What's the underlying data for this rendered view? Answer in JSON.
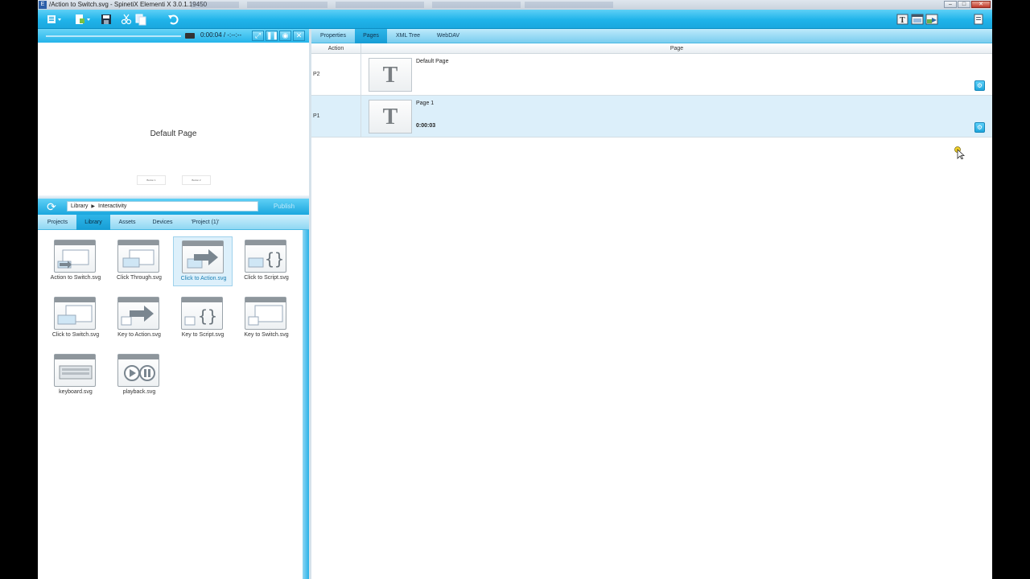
{
  "window": {
    "title": "/Action to Switch.svg - SpinetiX Elementi X 3.0.1.19450",
    "app_icon": "E",
    "controls": {
      "minimize": "–",
      "maximize": "□",
      "close": "✕"
    }
  },
  "toolbar": {
    "icons": [
      "menu-icon",
      "new-document-icon",
      "save-icon",
      "cut-icon",
      "copy-icon",
      "undo-icon",
      "text-layer-icon",
      "layout-icon",
      "media-icon",
      "page-icon"
    ]
  },
  "preview": {
    "timecode": "0:00:04 / -:--:--",
    "page_title": "Default Page",
    "mini_buttons": [
      "Button 1",
      "Button 2"
    ]
  },
  "library": {
    "breadcrumb": [
      "Library",
      "Interactivity"
    ],
    "publish_label": "Publish",
    "tabs": [
      "Projects",
      "Library",
      "Assets",
      "Devices",
      "'Project (1)'"
    ],
    "active_tab": "Library",
    "items": [
      {
        "label": "Action to Switch.svg",
        "icon": "action-to-switch-icon"
      },
      {
        "label": "Click Through.svg",
        "icon": "click-through-icon"
      },
      {
        "label": "Click to Action.svg",
        "icon": "click-to-action-icon",
        "selected": true
      },
      {
        "label": "Click to Script.svg",
        "icon": "click-to-script-icon"
      },
      {
        "label": "Click to Switch.svg",
        "icon": "click-to-switch-icon"
      },
      {
        "label": "Key to Action.svg",
        "icon": "key-to-action-icon"
      },
      {
        "label": "Key to Script.svg",
        "icon": "key-to-script-icon"
      },
      {
        "label": "Key to Switch.svg",
        "icon": "key-to-switch-icon"
      },
      {
        "label": "keyboard.svg",
        "icon": "keyboard-icon"
      },
      {
        "label": "playback.svg",
        "icon": "playback-icon"
      }
    ]
  },
  "right": {
    "tabs": [
      "Properties",
      "Pages",
      "XML Tree",
      "WebDAV"
    ],
    "active_tab": "Pages",
    "columns": {
      "action": "Action",
      "page": "Page"
    },
    "pages": [
      {
        "id": "P2",
        "name": "Default Page",
        "thumb": "T",
        "duration": ""
      },
      {
        "id": "P1",
        "name": "Page 1",
        "thumb": "T",
        "duration": "0:00:03",
        "selected": true
      }
    ]
  },
  "colors": {
    "accent": "#1fb0e6",
    "selection": "#dceffa"
  }
}
